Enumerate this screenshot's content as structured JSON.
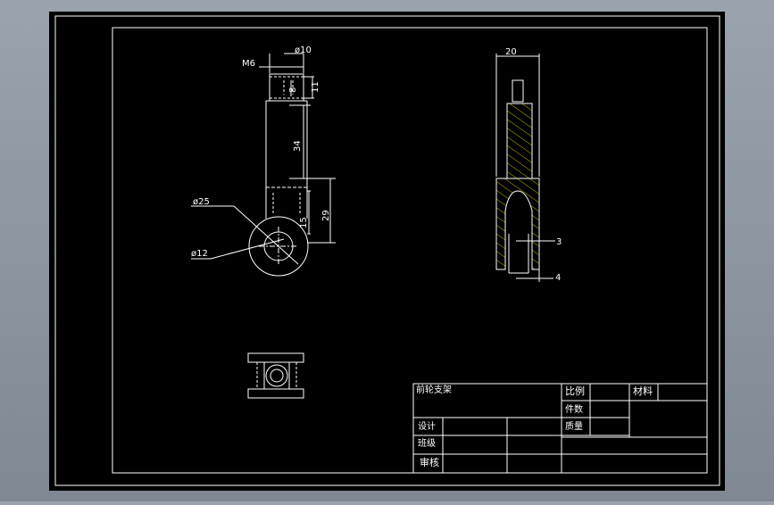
{
  "drawing": {
    "dimensions": {
      "m6": "M6",
      "d10": "ø10",
      "h11": "11",
      "h8": "8",
      "h34": "34",
      "d25": "ø25",
      "d12": "ø12",
      "h15": "15",
      "h29": "29",
      "w20": "20",
      "w3": "3",
      "w4": "4"
    }
  },
  "title_block": {
    "part_name": "前轮支架",
    "scale_label": "比例",
    "material_label": "材料",
    "quantity_label": "件数",
    "weight_label": "质量",
    "design_label": "设计",
    "class_label": "班级",
    "review_label": "审核"
  },
  "colors": {
    "background": "#000000",
    "line": "#ffffff",
    "hatch": "#c8b400",
    "frame": "#9aa3ad"
  }
}
